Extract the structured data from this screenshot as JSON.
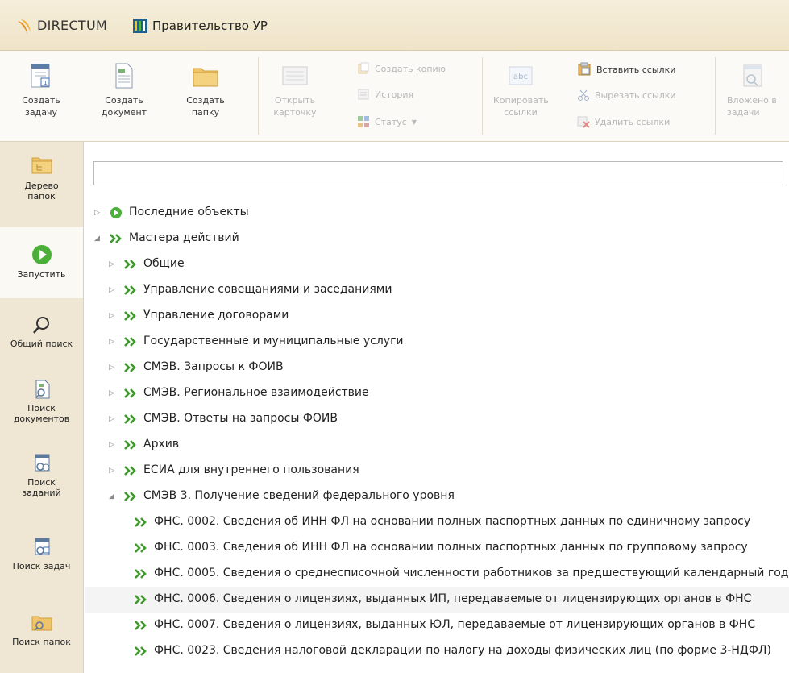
{
  "titlebar": {
    "brand": "DIRECTUM",
    "org": "Правительство УР"
  },
  "ribbon": {
    "create_task": "Создать\nзадачу",
    "create_document": "Создать\nдокумент",
    "create_folder": "Создать\nпапку",
    "open_card": "Открыть\nкарточку",
    "create_copy": "Создать копию",
    "history": "История",
    "status": "Статус",
    "copy_links": "Копировать\nссылки",
    "paste_links": "Вставить ссылки",
    "cut_links": "Вырезать ссылки",
    "delete_links": "Удалить ссылки",
    "nested_in_tasks": "Вложено в\nзадачи"
  },
  "sidebar": {
    "items": [
      {
        "label": "Дерево\nпапок"
      },
      {
        "label": "Запустить"
      },
      {
        "label": "Общий поиск"
      },
      {
        "label": "Поиск\nдокументов"
      },
      {
        "label": "Поиск\nзаданий"
      },
      {
        "label": "Поиск задач"
      },
      {
        "label": "Поиск папок"
      }
    ]
  },
  "search": {
    "placeholder": ""
  },
  "tree": {
    "rows": [
      {
        "text": "Последние объекты",
        "level": 0,
        "expander": "collapsed",
        "icon": "play-circle-icon"
      },
      {
        "text": "Мастера действий",
        "level": 0,
        "expander": "expanded",
        "icon": "double-chevron-icon"
      },
      {
        "text": "Общие",
        "level": 1,
        "expander": "collapsed",
        "icon": "double-chevron-icon"
      },
      {
        "text": "Управление совещаниями и заседаниями",
        "level": 1,
        "expander": "collapsed",
        "icon": "double-chevron-icon"
      },
      {
        "text": "Управление договорами",
        "level": 1,
        "expander": "collapsed",
        "icon": "double-chevron-icon"
      },
      {
        "text": "Государственные и муниципальные услуги",
        "level": 1,
        "expander": "collapsed",
        "icon": "double-chevron-icon"
      },
      {
        "text": "СМЭВ. Запросы к ФОИВ",
        "level": 1,
        "expander": "collapsed",
        "icon": "double-chevron-icon"
      },
      {
        "text": "СМЭВ. Региональное взаимодействие",
        "level": 1,
        "expander": "collapsed",
        "icon": "double-chevron-icon"
      },
      {
        "text": "СМЭВ. Ответы на запросы ФОИВ",
        "level": 1,
        "expander": "collapsed",
        "icon": "double-chevron-icon"
      },
      {
        "text": "Архив",
        "level": 1,
        "expander": "collapsed",
        "icon": "double-chevron-icon"
      },
      {
        "text": "ЕСИА для внутреннего пользования",
        "level": 1,
        "expander": "collapsed",
        "icon": "double-chevron-icon"
      },
      {
        "text": "СМЭВ 3. Получение сведений федерального уровня",
        "level": 1,
        "expander": "expanded",
        "icon": "double-chevron-icon"
      },
      {
        "text": "ФНС. 0002. Сведения об ИНН ФЛ на основании полных паспортных данных по единичному запросу",
        "level": 2,
        "expander": "none",
        "icon": "double-chevron-icon"
      },
      {
        "text": "ФНС. 0003. Сведения об ИНН ФЛ на основании полных паспортных данных по групповому запросу",
        "level": 2,
        "expander": "none",
        "icon": "double-chevron-icon"
      },
      {
        "text": "ФНС. 0005. Сведения о среднесписочной численности работников за предшествующий календарный год",
        "level": 2,
        "expander": "none",
        "icon": "double-chevron-icon"
      },
      {
        "text": "ФНС. 0006. Сведения о лицензиях, выданных ИП, передаваемые от лицензирующих органов в ФНС",
        "level": 2,
        "expander": "none",
        "icon": "double-chevron-icon",
        "highlighted": true
      },
      {
        "text": "ФНС. 0007. Сведения о лицензиях, выданных ЮЛ, передаваемые от лицензирующих органов в ФНС",
        "level": 2,
        "expander": "none",
        "icon": "double-chevron-icon"
      },
      {
        "text": "ФНС. 0023. Сведения налоговой декларации по налогу на доходы физических лиц (по форме 3-НДФЛ)",
        "level": 2,
        "expander": "none",
        "icon": "double-chevron-icon"
      }
    ]
  },
  "colors": {
    "accent_green": "#3f9a2c",
    "sidebar_bg": "#efe7d3",
    "titlebar_bg": "#efe4c8"
  }
}
